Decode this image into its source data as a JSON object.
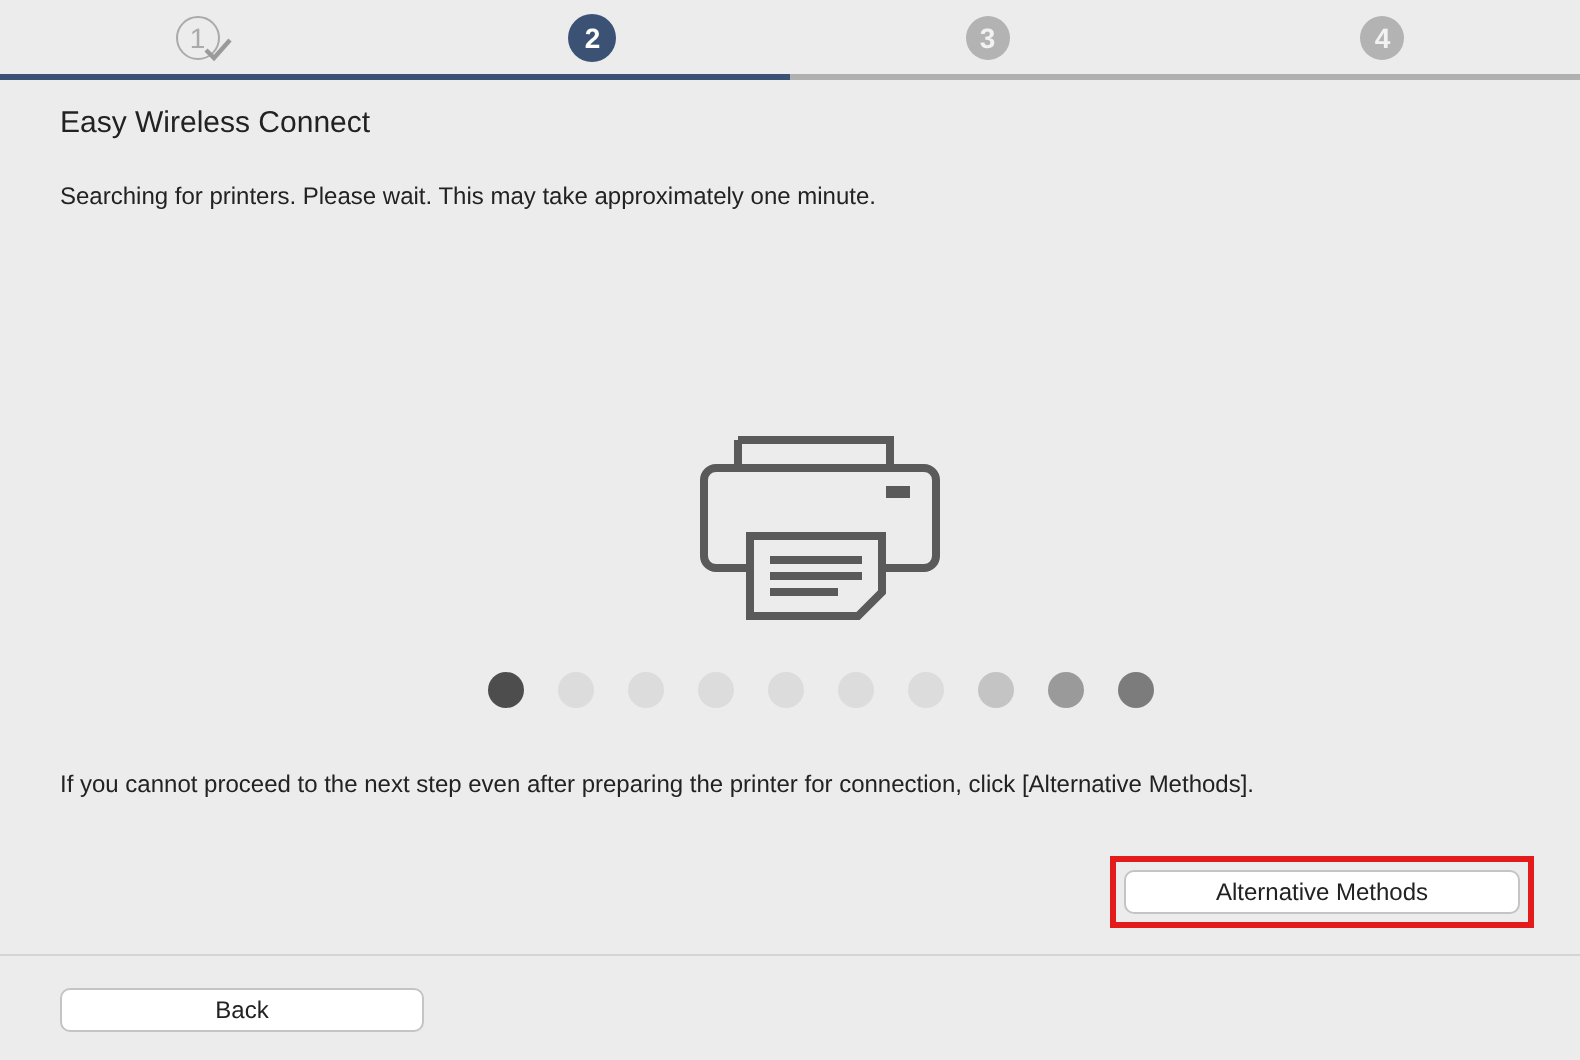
{
  "steps": [
    {
      "label": "1",
      "completed": true,
      "selected": false
    },
    {
      "label": "2",
      "completed": false,
      "selected": true
    },
    {
      "label": "3",
      "completed": false,
      "selected": false
    },
    {
      "label": "4",
      "completed": false,
      "selected": false
    }
  ],
  "title": "Easy Wireless Connect",
  "message": "Searching for printers. Please wait. This may take approximately one minute.",
  "progress_dots": [
    {
      "color": "#4d4d4d"
    },
    {
      "color": "#dcdcdc"
    },
    {
      "color": "#dcdcdc"
    },
    {
      "color": "#dcdcdc"
    },
    {
      "color": "#dcdcdc"
    },
    {
      "color": "#dcdcdc"
    },
    {
      "color": "#dcdcdc"
    },
    {
      "color": "#c4c4c4"
    },
    {
      "color": "#9a9a9a"
    },
    {
      "color": "#7c7c7c"
    }
  ],
  "note": "If you cannot proceed to the next step even after preparing the printer for connection, click [Alternative Methods].",
  "alternative_button": {
    "label": "Alternative Methods",
    "highlighted": true
  },
  "back_button": {
    "label": "Back"
  }
}
